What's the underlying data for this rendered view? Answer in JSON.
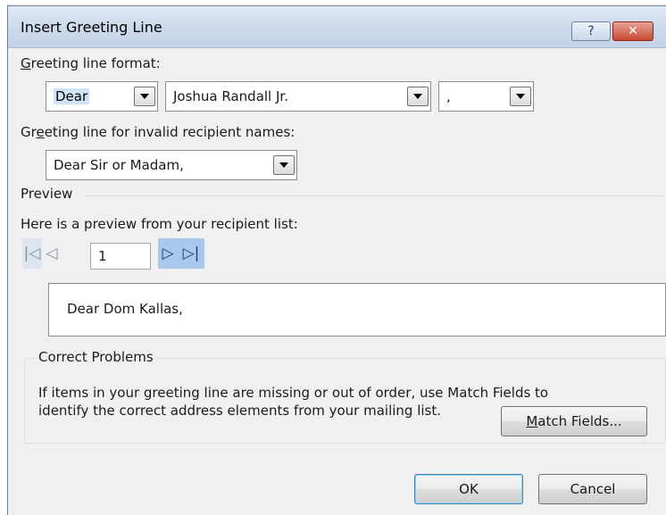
{
  "window": {
    "title": "Insert Greeting Line",
    "help_glyph": "?",
    "close_glyph": "✕"
  },
  "greeting_format": {
    "label_prefix": "G",
    "label_rest": "reeting line format:",
    "salutation": "Dear",
    "name_format": "Joshua Randall Jr.",
    "punctuation": ","
  },
  "invalid_names": {
    "label_pre": "Gr",
    "label_accel": "e",
    "label_rest": "eting line for invalid recipient names:",
    "value": "Dear Sir or Madam,"
  },
  "preview": {
    "section_label": "Preview",
    "description": "Here is a preview from your recipient list:",
    "record_number": "1",
    "first_glyph": "|◁",
    "prev_glyph": "◁",
    "next_glyph": "▷",
    "last_glyph": "▷|",
    "text": "Dear Dom Kallas,"
  },
  "correct_problems": {
    "title": "Correct Problems",
    "line1": "If items in your greeting line are missing or out of order, use Match Fields to",
    "line2": "identify the correct address elements from your mailing list.",
    "match_fields_accel": "M",
    "match_fields_rest": "atch Fields..."
  },
  "buttons": {
    "ok": "OK",
    "cancel": "Cancel"
  },
  "colors": {
    "selection": "#3399ff",
    "title_gradient_top": "#dfeaf6",
    "close_red": "#c74a33"
  }
}
